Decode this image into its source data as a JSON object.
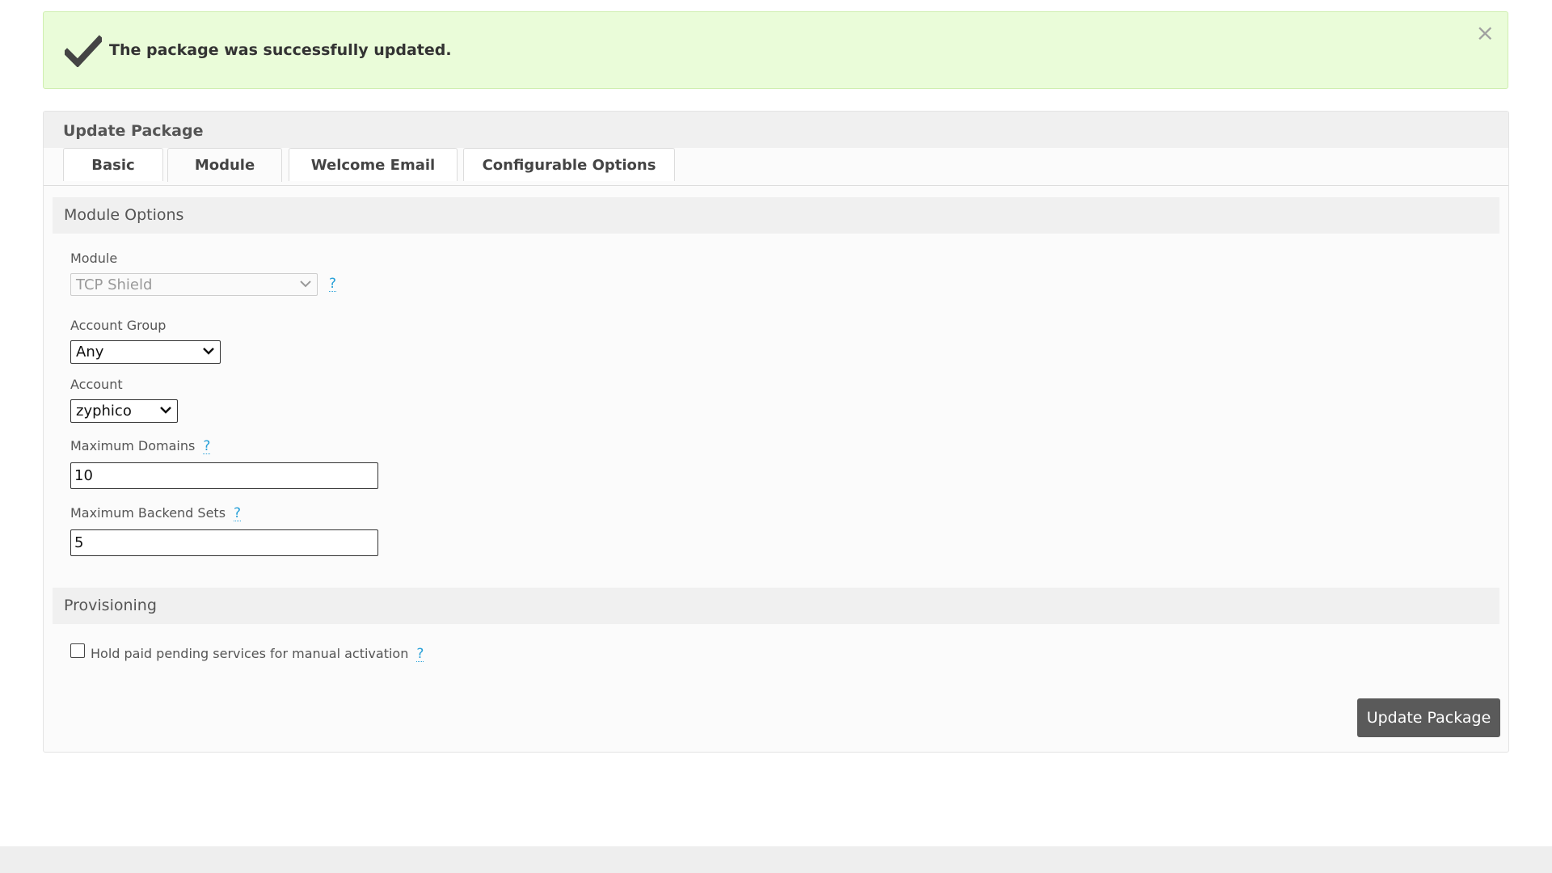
{
  "alert": {
    "message": "The package was successfully updated.",
    "close_glyph": "×",
    "icon": "checkmark-icon",
    "background": "#eafcd9"
  },
  "panel": {
    "title": "Update Package",
    "tabs": [
      {
        "label": "Basic",
        "active": false
      },
      {
        "label": "Module",
        "active": true
      },
      {
        "label": "Welcome Email",
        "active": false
      },
      {
        "label": "Configurable Options",
        "active": false
      }
    ]
  },
  "module_options": {
    "heading": "Module Options",
    "module": {
      "label": "Module",
      "value": "TCP Shield",
      "disabled": true,
      "help": "?"
    },
    "account_group": {
      "label": "Account Group",
      "value": "Any"
    },
    "account": {
      "label": "Account",
      "value": "zyphico"
    },
    "maximum_domains": {
      "label": "Maximum Domains",
      "value": "10",
      "help": "?"
    },
    "maximum_backend_sets": {
      "label": "Maximum Backend Sets",
      "value": "5",
      "help": "?"
    }
  },
  "provisioning": {
    "heading": "Provisioning",
    "hold_label": "Hold paid pending services for manual activation",
    "hold_checked": false,
    "help": "?"
  },
  "actions": {
    "update_label": "Update Package",
    "button_color": "#5a5a5a"
  },
  "colors": {
    "help_link": "#27a0d8"
  }
}
